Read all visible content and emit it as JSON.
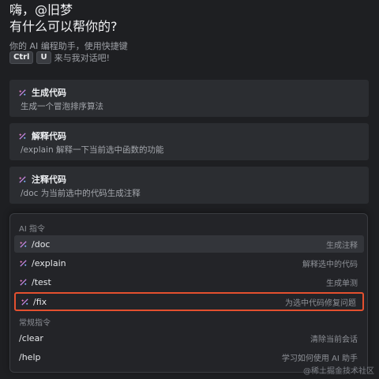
{
  "header": {
    "greeting": "嗨，@旧梦",
    "subtitle": "有什么可以帮你的?"
  },
  "intro": {
    "text": "你的 AI 编程助手，使用快捷键",
    "key1": "Ctrl",
    "key2": "U",
    "suffix": "来与我对话吧!"
  },
  "cards": [
    {
      "title": "生成代码",
      "desc": "生成一个冒泡排序算法"
    },
    {
      "title": "解释代码",
      "desc": "/explain 解释一下当前选中函数的功能"
    },
    {
      "title": "注释代码",
      "desc": "/doc 为当前选中的代码生成注释"
    }
  ],
  "popup": {
    "ai_label": "AI 指令",
    "ai_commands": [
      {
        "cmd": "/doc",
        "hint": "生成注释"
      },
      {
        "cmd": "/explain",
        "hint": "解释选中的代码"
      },
      {
        "cmd": "/test",
        "hint": "生成单测"
      },
      {
        "cmd": "/fix",
        "hint": "为选中代码修复问题"
      }
    ],
    "common_label": "常规指令",
    "common_commands": [
      {
        "cmd": "/clear",
        "hint": "清除当前会话"
      },
      {
        "cmd": "/help",
        "hint": "学习如何使用 AI 助手"
      }
    ]
  },
  "watermark": "@稀土掘金技术社区",
  "colors": {
    "background": "#1e1f22",
    "card": "#2b2d31",
    "highlight": "#e4502f"
  }
}
